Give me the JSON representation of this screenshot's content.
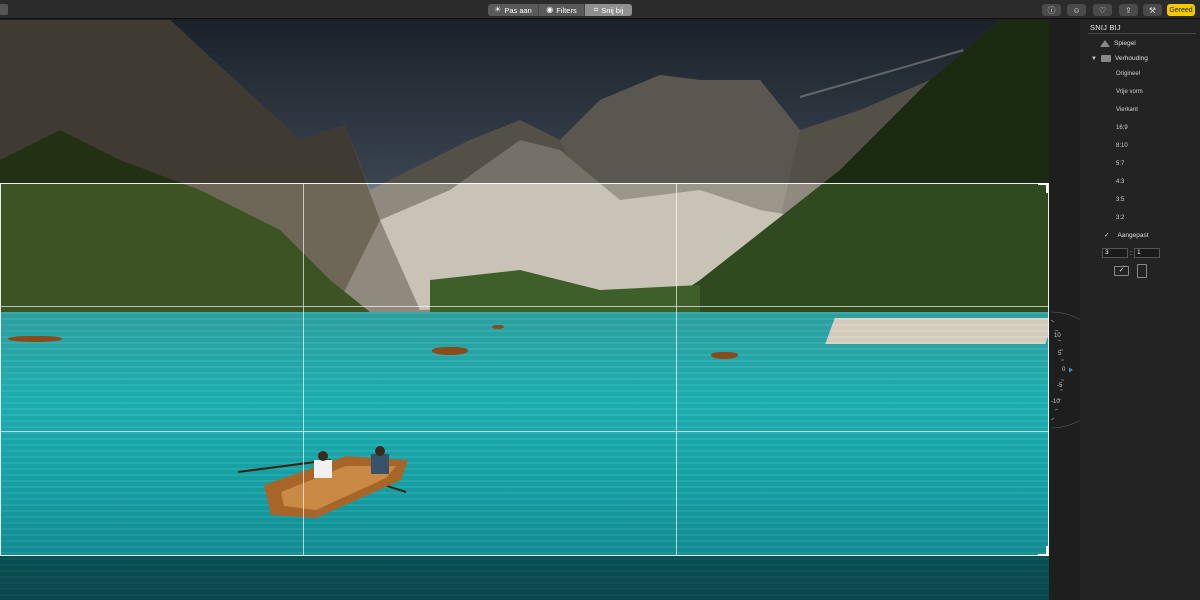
{
  "toolbar": {
    "tabs": [
      {
        "label": "Pas aan",
        "icon": "sun-icon"
      },
      {
        "label": "Filters",
        "icon": "filter-icon"
      },
      {
        "label": "Snij bij",
        "icon": "crop-icon"
      }
    ],
    "active_tab": "Snij bij",
    "right_buttons": [
      "info-icon",
      "emoji-icon",
      "heart-icon",
      "share-icon",
      "wand-icon"
    ],
    "done_label": "Gereed",
    "done_color": "#f3c900"
  },
  "dial": {
    "labels": [
      "10",
      "5",
      "0",
      "-5",
      "-10"
    ],
    "value": 0
  },
  "panel": {
    "title": "SNIJ BIJ",
    "mirror_label": "Spiegel",
    "aspect_label": "Verhouding",
    "aspect_options": [
      "Origineel",
      "Vrije vorm",
      "Vierkant",
      "16:9",
      "8:10",
      "5:7",
      "4:3",
      "3:5",
      "3:2"
    ],
    "custom_label": "Aangepast",
    "custom_checked": true,
    "custom_width": "3",
    "custom_height": "1",
    "colon": ":"
  }
}
